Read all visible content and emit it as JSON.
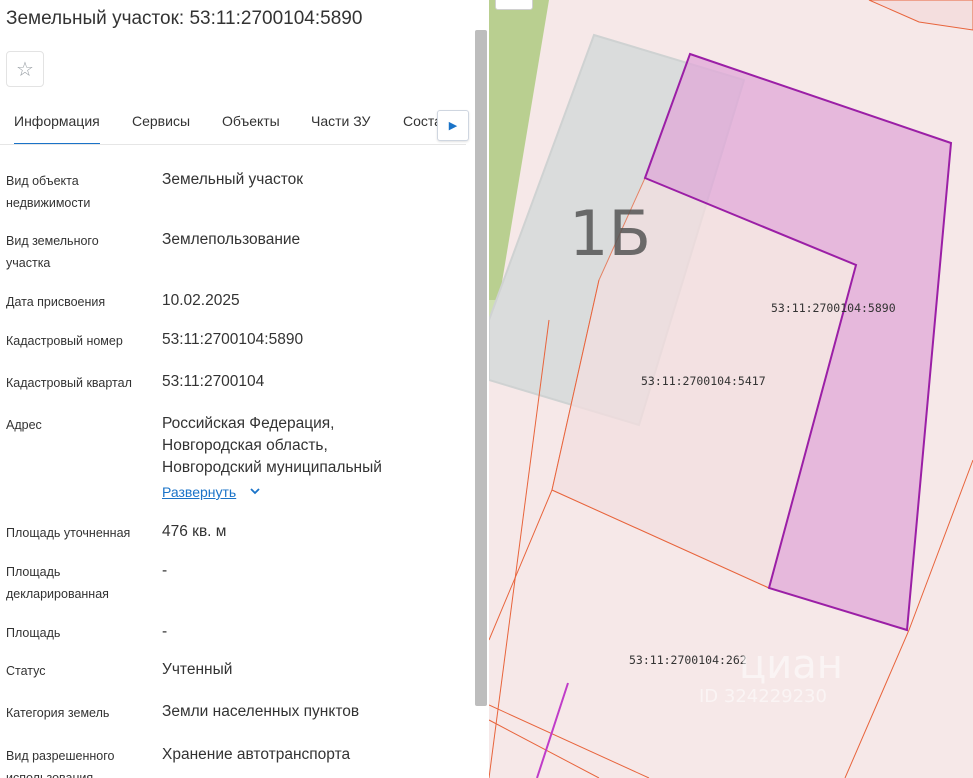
{
  "header": {
    "title": "Земельный участок: 53:11:2700104:5890"
  },
  "tabs": [
    {
      "label": "Информация"
    },
    {
      "label": "Сервисы"
    },
    {
      "label": "Объекты"
    },
    {
      "label": "Части ЗУ"
    },
    {
      "label": "Соста"
    }
  ],
  "info": {
    "object_type_label": "Вид объекта недвижимости",
    "object_type_value": "Земельный участок",
    "land_kind_label": "Вид земельного участка",
    "land_kind_value": "Землепользование",
    "assign_date_label": "Дата присвоения",
    "assign_date_value": "10.02.2025",
    "cad_number_label": "Кадастровый номер",
    "cad_number_value": "53:11:2700104:5890",
    "cad_quarter_label": "Кадастровый квартал",
    "cad_quarter_value": "53:11:2700104",
    "address_label": "Адрес",
    "address_lines": [
      "Российская Федерация,",
      "Новгородская область,",
      "Новгородский муниципальный"
    ],
    "expand_label": "Развернуть",
    "area_refined_label": "Площадь уточненная",
    "area_refined_value": "476 кв. м",
    "area_declared_label": "Площадь декларированная",
    "area_declared_value": "-",
    "area_label": "Площадь",
    "area_value": "-",
    "status_label": "Статус",
    "status_value": "Учтенный",
    "land_category_label": "Категория земель",
    "land_category_value": "Земли населенных пунктов",
    "permitted_use_label": "Вид разрешенного использования",
    "permitted_use_value": "Хранение автотранспорта"
  },
  "map": {
    "house_number": "1Б",
    "parcel_labels": [
      "53:11:2700104:5890",
      "53:11:2700104:5417",
      "53:11:2700104:262"
    ],
    "watermark_text": "циан",
    "watermark_id": "ID 324229230",
    "colors": {
      "selected_fill": "#e0a8d8",
      "selected_stroke": "#9b1fa6",
      "parcel_stroke": "#e8643c",
      "parcel_fill": "#f6e4e4",
      "building_fill": "#dadcdc",
      "green_strip": "#b9cf90"
    }
  }
}
